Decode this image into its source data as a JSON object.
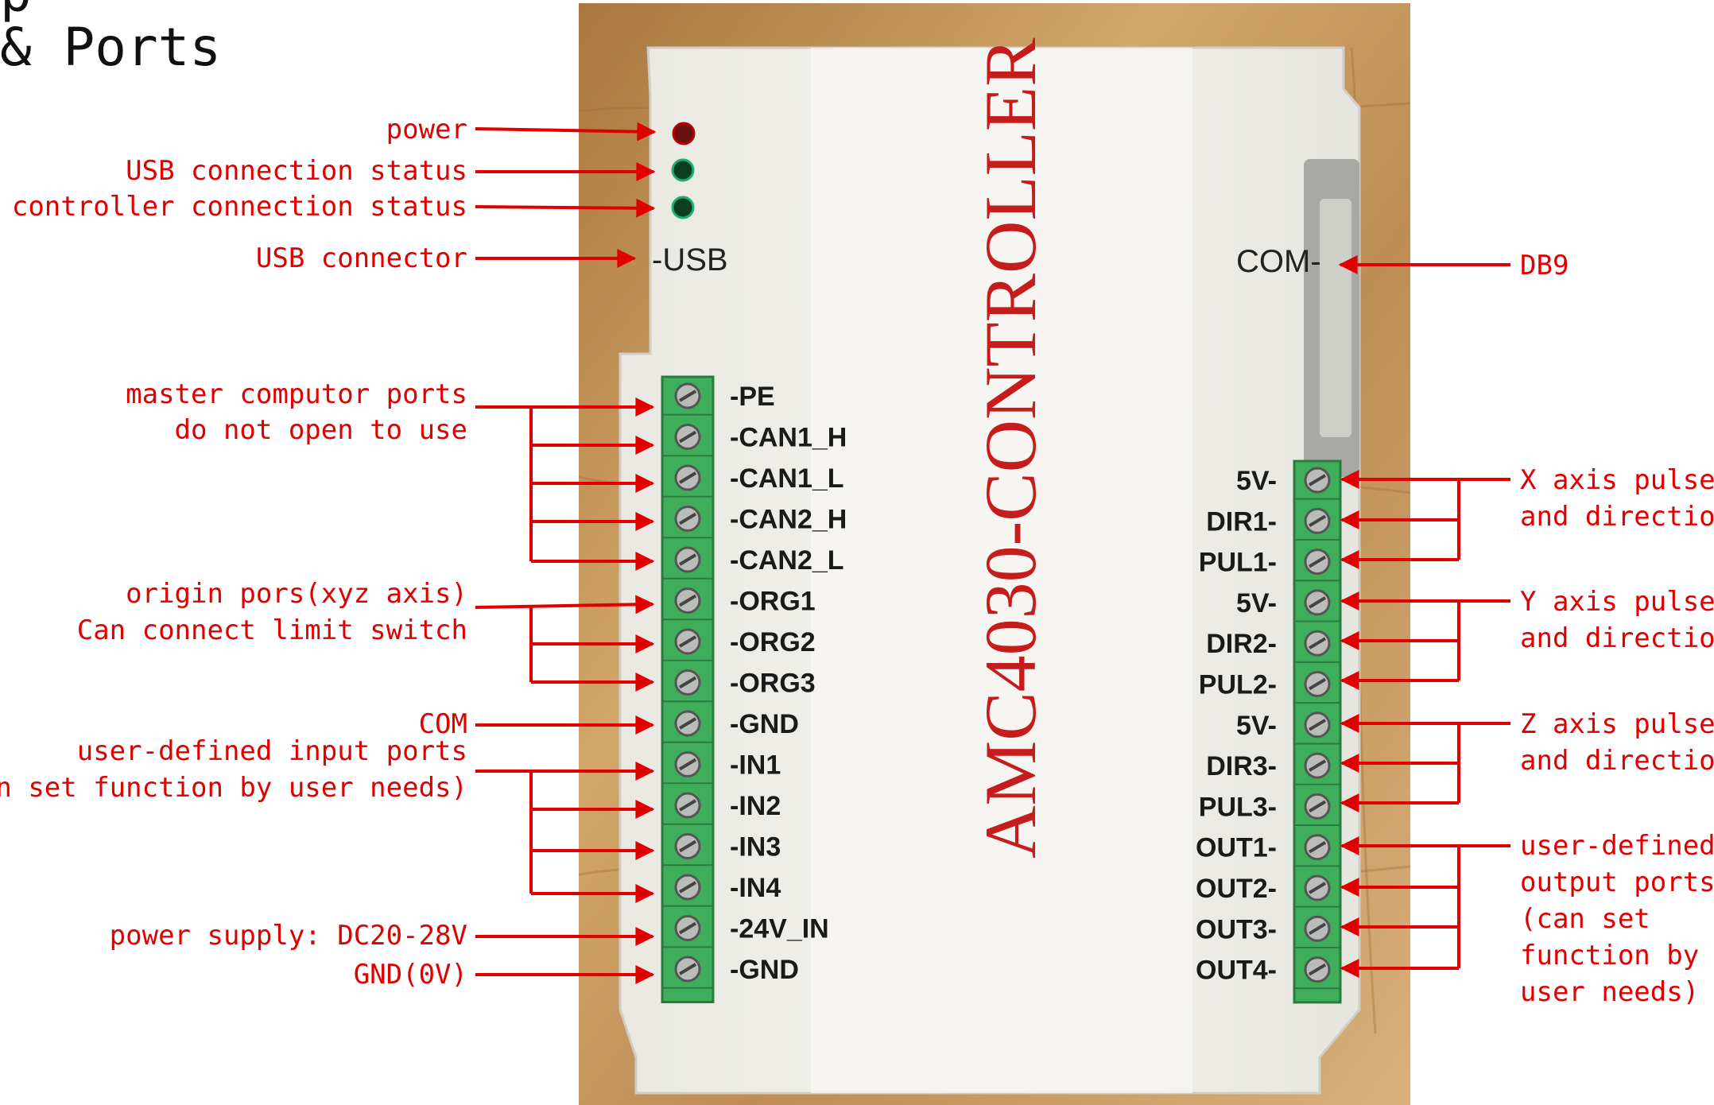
{
  "heading": {
    "partial": "p",
    "text": "& Ports"
  },
  "device": {
    "brand": "AMC4030-CONTROLLER",
    "usb_label": "-USB",
    "com_label": "COM-"
  },
  "left_terminal": [
    "-PE",
    "-CAN1_H",
    "-CAN1_L",
    "-CAN2_H",
    "-CAN2_L",
    "-ORG1",
    "-ORG2",
    "-ORG3",
    "-GND",
    "-IN1",
    "-IN2",
    "-IN3",
    "-IN4",
    "-24V_IN",
    "-GND"
  ],
  "right_terminal": [
    "5V-",
    "DIR1-",
    "PUL1-",
    "5V-",
    "DIR2-",
    "PUL2-",
    "5V-",
    "DIR3-",
    "PUL3-",
    "OUT1-",
    "OUT2-",
    "OUT3-",
    "OUT4-"
  ],
  "annotations_left": {
    "power": "power",
    "usb_status": "USB connection status",
    "ctrl_status": "controller connection status",
    "usb_connector": "USB connector",
    "master_1": "master computor ports",
    "master_2": "do not open to use",
    "origin_1": "origin pors(xyz axis)",
    "origin_2": "Can connect limit switch",
    "com": "COM",
    "user_in_1": "user-defined input ports",
    "user_in_2": "(can set function by user needs)",
    "power_supply": "power supply: DC20-28V",
    "gnd": "GND(0V)"
  },
  "annotations_right": {
    "db9": "DB9",
    "x_1": "X axis pulses",
    "x_2": "and direction",
    "y_1": "Y axis pulses",
    "y_2": "and direction",
    "z_1": "Z axis pulses",
    "z_2": "and direction",
    "out_1": "user-defined",
    "out_2": "output ports",
    "out_3": "(can set",
    "out_4": "function by",
    "out_5": "user needs)"
  },
  "colors": {
    "annotation": "#e00000",
    "terminal": "#3fae5a",
    "board": "#eeeeea",
    "wood": "#c79a62"
  }
}
